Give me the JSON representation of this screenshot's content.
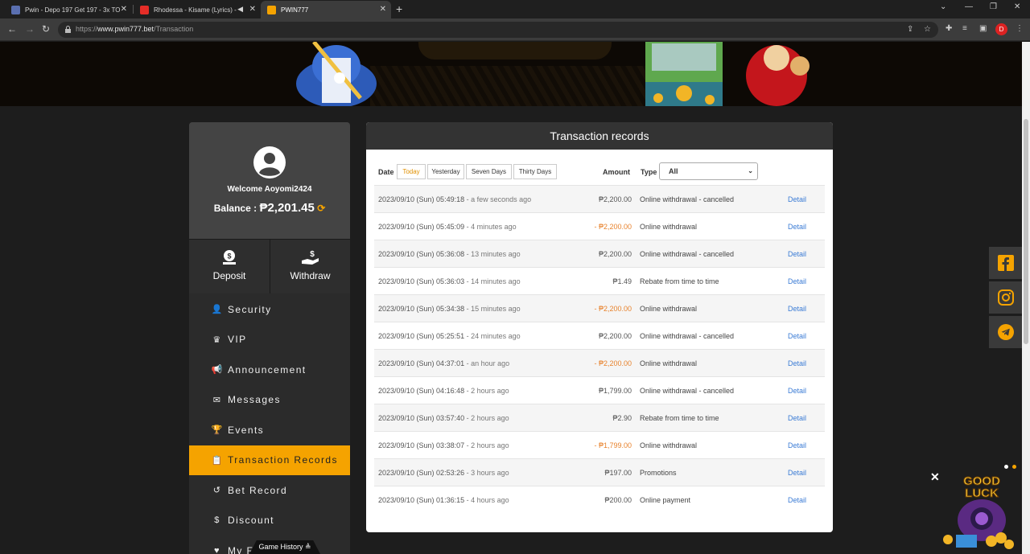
{
  "browser": {
    "tabs": [
      {
        "title": "Pwin - Depo 197 Get 197 - 3x TO",
        "active": false
      },
      {
        "title": "Rhodessa - Kisame (Lyrics) -",
        "active": false
      },
      {
        "title": "PWIN777",
        "active": true
      }
    ],
    "url_scheme": "https://",
    "url_host": "www.pwin777.bet",
    "url_path": "/Transaction",
    "profile_initial": "D"
  },
  "sidebar": {
    "welcome": "Welcome Aoyomi2424",
    "balance_label": "Balance :",
    "balance_value": "₱2,201.45",
    "deposit_label": "Deposit",
    "withdraw_label": "Withdraw",
    "menu": [
      {
        "label": "Security",
        "icon": "user-lock-icon"
      },
      {
        "label": "VIP",
        "icon": "crown-icon"
      },
      {
        "label": "Announcement",
        "icon": "megaphone-icon"
      },
      {
        "label": "Messages",
        "icon": "envelope-icon"
      },
      {
        "label": "Events",
        "icon": "trophy-icon"
      },
      {
        "label": "Transaction Records",
        "icon": "clipboard-icon",
        "active": true
      },
      {
        "label": "Bet Record",
        "icon": "history-icon"
      },
      {
        "label": "Discount",
        "icon": "dollar-circle-icon"
      },
      {
        "label": "My F",
        "icon": "heart-icon"
      }
    ],
    "game_history": "Game History ≜"
  },
  "records": {
    "title": "Transaction records",
    "date_label": "Date",
    "date_filters": [
      "Today",
      "Yesterday",
      "Seven Days",
      "Thirty Days"
    ],
    "selected_filter": "Today",
    "amount_label": "Amount",
    "type_label": "Type",
    "type_value": "All",
    "detail_label": "Detail",
    "rows": [
      {
        "date": "2023/09/10 (Sun) 05:49:18",
        "ago": " - a few seconds ago",
        "amount": "₱2,200.00",
        "negative": false,
        "type": "Online withdrawal - cancelled"
      },
      {
        "date": "2023/09/10 (Sun) 05:45:09",
        "ago": " - 4 minutes ago",
        "amount": "- ₱2,200.00",
        "negative": true,
        "type": "Online withdrawal"
      },
      {
        "date": "2023/09/10 (Sun) 05:36:08",
        "ago": " - 13 minutes ago",
        "amount": "₱2,200.00",
        "negative": false,
        "type": "Online withdrawal - cancelled"
      },
      {
        "date": "2023/09/10 (Sun) 05:36:03",
        "ago": " - 14 minutes ago",
        "amount": "₱1.49",
        "negative": false,
        "type": "Rebate from time to time"
      },
      {
        "date": "2023/09/10 (Sun) 05:34:38",
        "ago": " - 15 minutes ago",
        "amount": "- ₱2,200.00",
        "negative": true,
        "type": "Online withdrawal"
      },
      {
        "date": "2023/09/10 (Sun) 05:25:51",
        "ago": " - 24 minutes ago",
        "amount": "₱2,200.00",
        "negative": false,
        "type": "Online withdrawal - cancelled"
      },
      {
        "date": "2023/09/10 (Sun) 04:37:01",
        "ago": " - an hour ago",
        "amount": "- ₱2,200.00",
        "negative": true,
        "type": "Online withdrawal"
      },
      {
        "date": "2023/09/10 (Sun) 04:16:48",
        "ago": " - 2 hours ago",
        "amount": "₱1,799.00",
        "negative": false,
        "type": "Online withdrawal - cancelled"
      },
      {
        "date": "2023/09/10 (Sun) 03:57:40",
        "ago": " - 2 hours ago",
        "amount": "₱2.90",
        "negative": false,
        "type": "Rebate from time to time"
      },
      {
        "date": "2023/09/10 (Sun) 03:38:07",
        "ago": " - 2 hours ago",
        "amount": "- ₱1,799.00",
        "negative": true,
        "type": "Online withdrawal"
      },
      {
        "date": "2023/09/10 (Sun) 02:53:26",
        "ago": " - 3 hours ago",
        "amount": "₱197.00",
        "negative": false,
        "type": "Promotions"
      },
      {
        "date": "2023/09/10 (Sun) 01:36:15",
        "ago": " - 4 hours ago",
        "amount": "₱200.00",
        "negative": false,
        "type": "Online payment"
      }
    ]
  },
  "social": [
    "facebook-icon",
    "instagram-icon",
    "telegram-icon"
  ],
  "colors": {
    "accent": "#f5a300",
    "negative": "#e8832e",
    "link": "#3a7bd5"
  }
}
